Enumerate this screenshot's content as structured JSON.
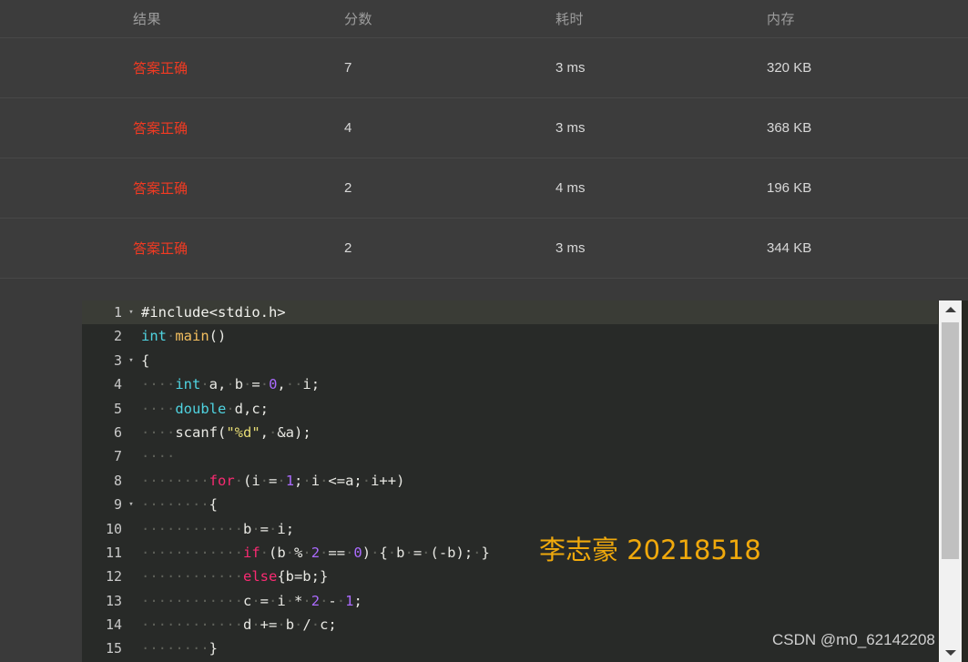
{
  "results": {
    "headers": [
      "结果",
      "分数",
      "耗时",
      "内存"
    ],
    "rows": [
      {
        "verdict": "答案正确",
        "score": "7",
        "time": "3 ms",
        "memory": "320 KB"
      },
      {
        "verdict": "答案正确",
        "score": "4",
        "time": "3 ms",
        "memory": "368 KB"
      },
      {
        "verdict": "答案正确",
        "score": "2",
        "time": "4 ms",
        "memory": "196 KB"
      },
      {
        "verdict": "答案正确",
        "score": "2",
        "time": "3 ms",
        "memory": "344 KB"
      }
    ],
    "verdict_color": "#f23a22",
    "header_color": "#9d9d9d",
    "value_color": "#d8d8d8",
    "row_background": "#3c3c3c"
  },
  "editor": {
    "background": "#282a28",
    "active_line_background": "#3a3c36",
    "gutter_color": "#c9c9c9",
    "lines": [
      {
        "number": "1",
        "fold": "▾",
        "active": true,
        "tokens": [
          {
            "t": "#include<stdio.h>",
            "c": "tk-pre"
          }
        ]
      },
      {
        "number": "2",
        "fold": "",
        "active": false,
        "tokens": [
          {
            "t": "int",
            "c": "tk-type"
          },
          {
            "t": "·",
            "c": "tk-ws"
          },
          {
            "t": "main",
            "c": "tk-fn"
          },
          {
            "t": "()",
            "c": ""
          }
        ]
      },
      {
        "number": "3",
        "fold": "▾",
        "active": false,
        "tokens": [
          {
            "t": "{",
            "c": ""
          }
        ]
      },
      {
        "number": "4",
        "fold": "",
        "active": false,
        "tokens": [
          {
            "t": "····",
            "c": "tk-ws"
          },
          {
            "t": "int",
            "c": "tk-type"
          },
          {
            "t": "·",
            "c": "tk-ws"
          },
          {
            "t": "a,",
            "c": ""
          },
          {
            "t": "·",
            "c": "tk-ws"
          },
          {
            "t": "b",
            "c": ""
          },
          {
            "t": "·",
            "c": "tk-ws"
          },
          {
            "t": "=",
            "c": ""
          },
          {
            "t": "·",
            "c": "tk-ws"
          },
          {
            "t": "0",
            "c": "tk-num"
          },
          {
            "t": ",",
            "c": ""
          },
          {
            "t": "··",
            "c": "tk-ws"
          },
          {
            "t": "i;",
            "c": ""
          }
        ]
      },
      {
        "number": "5",
        "fold": "",
        "active": false,
        "tokens": [
          {
            "t": "····",
            "c": "tk-ws"
          },
          {
            "t": "double",
            "c": "tk-type"
          },
          {
            "t": "·",
            "c": "tk-ws"
          },
          {
            "t": "d,c;",
            "c": ""
          }
        ]
      },
      {
        "number": "6",
        "fold": "",
        "active": false,
        "tokens": [
          {
            "t": "····",
            "c": "tk-ws"
          },
          {
            "t": "scanf(",
            "c": ""
          },
          {
            "t": "\"%d\"",
            "c": "tk-str"
          },
          {
            "t": ",",
            "c": ""
          },
          {
            "t": "·",
            "c": "tk-ws"
          },
          {
            "t": "&a);",
            "c": ""
          }
        ]
      },
      {
        "number": "7",
        "fold": "",
        "active": false,
        "tokens": [
          {
            "t": "····",
            "c": "tk-ws"
          }
        ]
      },
      {
        "number": "8",
        "fold": "",
        "active": false,
        "tokens": [
          {
            "t": "········",
            "c": "tk-ws"
          },
          {
            "t": "for",
            "c": "tk-kw"
          },
          {
            "t": "·",
            "c": "tk-ws"
          },
          {
            "t": "(i",
            "c": ""
          },
          {
            "t": "·",
            "c": "tk-ws"
          },
          {
            "t": "=",
            "c": ""
          },
          {
            "t": "·",
            "c": "tk-ws"
          },
          {
            "t": "1",
            "c": "tk-num"
          },
          {
            "t": ";",
            "c": ""
          },
          {
            "t": "·",
            "c": "tk-ws"
          },
          {
            "t": "i",
            "c": ""
          },
          {
            "t": "·",
            "c": "tk-ws"
          },
          {
            "t": "<=a;",
            "c": ""
          },
          {
            "t": "·",
            "c": "tk-ws"
          },
          {
            "t": "i++)",
            "c": ""
          }
        ]
      },
      {
        "number": "9",
        "fold": "▾",
        "active": false,
        "tokens": [
          {
            "t": "········",
            "c": "tk-ws"
          },
          {
            "t": "{",
            "c": ""
          }
        ]
      },
      {
        "number": "10",
        "fold": "",
        "active": false,
        "tokens": [
          {
            "t": "············",
            "c": "tk-ws"
          },
          {
            "t": "b",
            "c": ""
          },
          {
            "t": "·",
            "c": "tk-ws"
          },
          {
            "t": "=",
            "c": ""
          },
          {
            "t": "·",
            "c": "tk-ws"
          },
          {
            "t": "i;",
            "c": ""
          }
        ]
      },
      {
        "number": "11",
        "fold": "",
        "active": false,
        "tokens": [
          {
            "t": "············",
            "c": "tk-ws"
          },
          {
            "t": "if",
            "c": "tk-kw"
          },
          {
            "t": "·",
            "c": "tk-ws"
          },
          {
            "t": "(b",
            "c": ""
          },
          {
            "t": "·",
            "c": "tk-ws"
          },
          {
            "t": "%",
            "c": ""
          },
          {
            "t": "·",
            "c": "tk-ws"
          },
          {
            "t": "2",
            "c": "tk-num"
          },
          {
            "t": "·",
            "c": "tk-ws"
          },
          {
            "t": "==",
            "c": ""
          },
          {
            "t": "·",
            "c": "tk-ws"
          },
          {
            "t": "0",
            "c": "tk-num"
          },
          {
            "t": ")",
            "c": ""
          },
          {
            "t": "·",
            "c": "tk-ws"
          },
          {
            "t": "{",
            "c": ""
          },
          {
            "t": "·",
            "c": "tk-ws"
          },
          {
            "t": "b",
            "c": ""
          },
          {
            "t": "·",
            "c": "tk-ws"
          },
          {
            "t": "=",
            "c": ""
          },
          {
            "t": "·",
            "c": "tk-ws"
          },
          {
            "t": "(-b);",
            "c": ""
          },
          {
            "t": "·",
            "c": "tk-ws"
          },
          {
            "t": "}",
            "c": ""
          }
        ]
      },
      {
        "number": "12",
        "fold": "",
        "active": false,
        "tokens": [
          {
            "t": "············",
            "c": "tk-ws"
          },
          {
            "t": "else",
            "c": "tk-kw"
          },
          {
            "t": "{b=b;}",
            "c": ""
          }
        ]
      },
      {
        "number": "13",
        "fold": "",
        "active": false,
        "tokens": [
          {
            "t": "············",
            "c": "tk-ws"
          },
          {
            "t": "c",
            "c": ""
          },
          {
            "t": "·",
            "c": "tk-ws"
          },
          {
            "t": "=",
            "c": ""
          },
          {
            "t": "·",
            "c": "tk-ws"
          },
          {
            "t": "i",
            "c": ""
          },
          {
            "t": "·",
            "c": "tk-ws"
          },
          {
            "t": "*",
            "c": ""
          },
          {
            "t": "·",
            "c": "tk-ws"
          },
          {
            "t": "2",
            "c": "tk-num"
          },
          {
            "t": "·",
            "c": "tk-ws"
          },
          {
            "t": "-",
            "c": ""
          },
          {
            "t": "·",
            "c": "tk-ws"
          },
          {
            "t": "1",
            "c": "tk-num"
          },
          {
            "t": ";",
            "c": ""
          }
        ]
      },
      {
        "number": "14",
        "fold": "",
        "active": false,
        "tokens": [
          {
            "t": "············",
            "c": "tk-ws"
          },
          {
            "t": "d",
            "c": ""
          },
          {
            "t": "·",
            "c": "tk-ws"
          },
          {
            "t": "+=",
            "c": ""
          },
          {
            "t": "·",
            "c": "tk-ws"
          },
          {
            "t": "b",
            "c": ""
          },
          {
            "t": "·",
            "c": "tk-ws"
          },
          {
            "t": "/",
            "c": ""
          },
          {
            "t": "·",
            "c": "tk-ws"
          },
          {
            "t": "c;",
            "c": ""
          }
        ]
      },
      {
        "number": "15",
        "fold": "",
        "active": false,
        "tokens": [
          {
            "t": "········",
            "c": "tk-ws"
          },
          {
            "t": "}",
            "c": ""
          }
        ]
      }
    ]
  },
  "watermarks": {
    "author": "李志豪 20218518",
    "author_color": "#f0a90c",
    "csdn": "CSDN @m0_62142208",
    "csdn_color": "#cfcfcf"
  },
  "scrollbar": {
    "up_arrow": "▲",
    "down_arrow": "▼",
    "track_color": "#f1f1f1",
    "thumb_color": "#c0c0c0"
  }
}
